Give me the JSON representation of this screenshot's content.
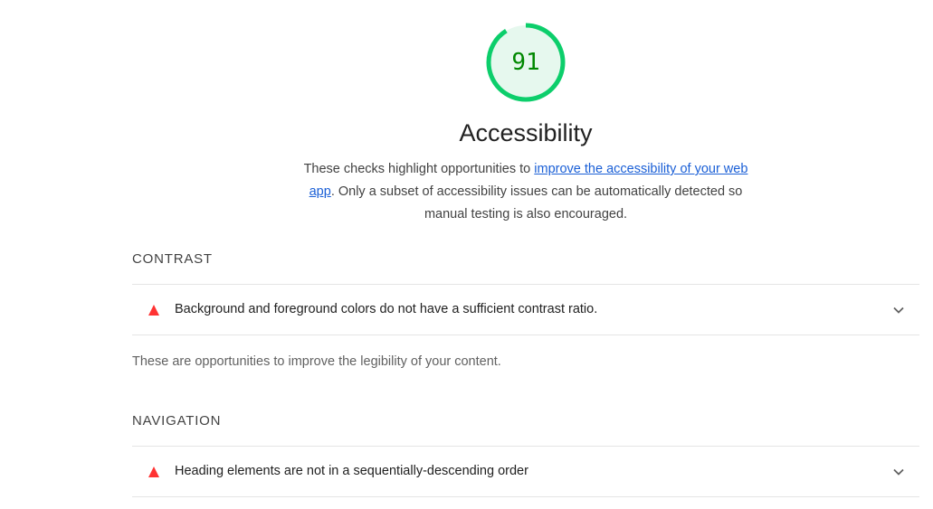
{
  "gauge": {
    "score": "91",
    "fraction": 0.91,
    "color": "#0cce6b",
    "text_color": "#008800",
    "fill_color": "#e6f8ee"
  },
  "category": {
    "title": "Accessibility",
    "desc_prefix": "These checks highlight opportunities to ",
    "desc_link": "improve the accessibility of your web app",
    "desc_suffix": ". Only a subset of accessibility issues can be automatically detected so manual testing is also encouraged."
  },
  "groups": {
    "contrast": {
      "title": "CONTRAST",
      "audit_title": "Background and foreground colors do not have a sufficient contrast ratio.",
      "description": "These are opportunities to improve the legibility of your content."
    },
    "navigation": {
      "title": "NAVIGATION",
      "audit_title": "Heading elements are not in a sequentially-descending order"
    }
  },
  "icons": {
    "fail": "fail-triangle-icon",
    "expand": "chevron-down-icon",
    "fail_color": "#ff3333"
  }
}
